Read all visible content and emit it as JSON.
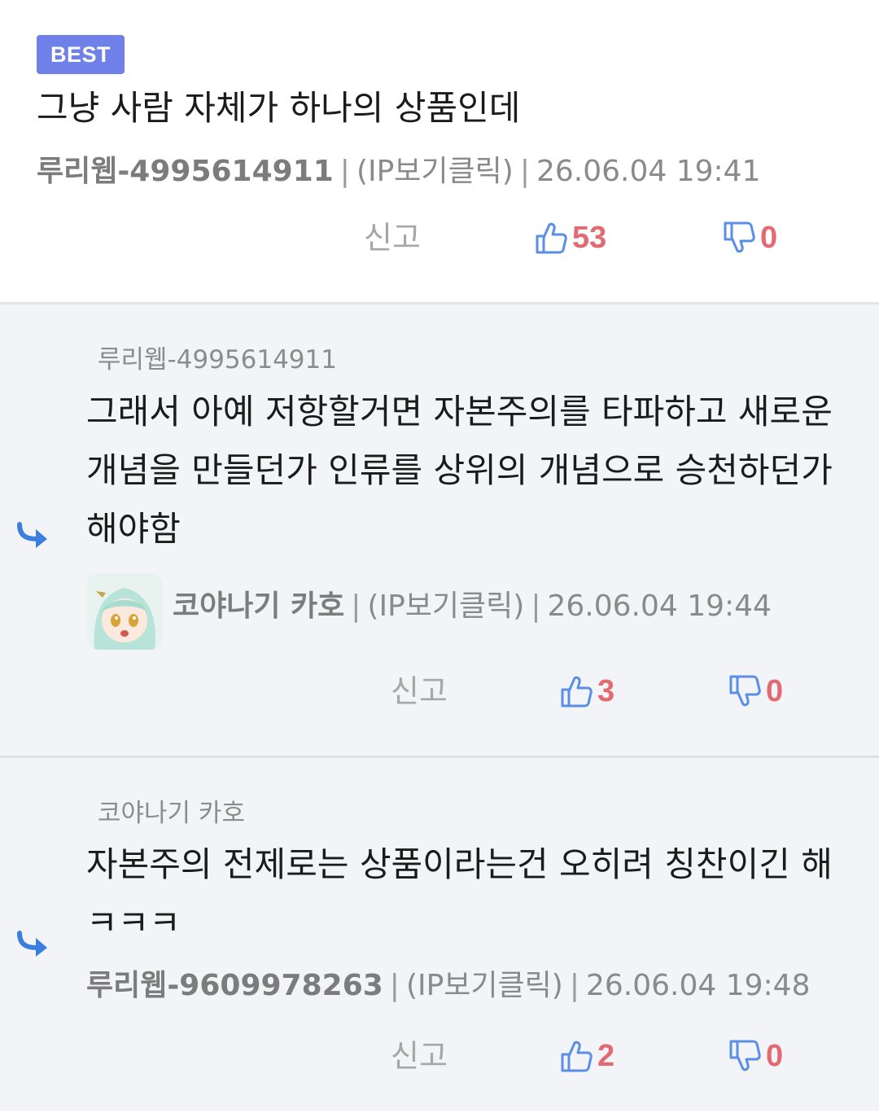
{
  "comments": [
    {
      "badge": "BEST",
      "text": "그냥 사람 자체가 하나의 상품인데",
      "author": "루리웹-4995614911",
      "ip": "(IP보기클릭)",
      "date": "26.06.04 19:41",
      "report": "신고",
      "likes": "53",
      "dislikes": "0"
    },
    {
      "reply_to": "루리웹-4995614911",
      "text": "그래서 아예 저항할거면 자본주의를 타파하고 새로운 개념을 만들던가 인류를 상위의 개념으로 승천하던가 해야함",
      "author": "코야나기 카호",
      "ip": "(IP보기클릭)",
      "date": "26.06.04 19:44",
      "report": "신고",
      "likes": "3",
      "dislikes": "0"
    },
    {
      "reply_to": "코야나기 카호",
      "text": "자본주의 전제로는 상품이라는건 오히려 칭찬이긴 해 ㅋㅋㅋ",
      "author": "루리웹-9609978263",
      "ip": "(IP보기클릭)",
      "date": "26.06.04 19:48",
      "report": "신고",
      "likes": "2",
      "dislikes": "0"
    }
  ],
  "separator": "|",
  "icons": {
    "like": "thumbs-up-icon",
    "dislike": "thumbs-down-icon",
    "reply": "reply-arrow-icon"
  },
  "colors": {
    "badge": "#6f80e8",
    "vote_count": "#e36a72",
    "thumb_icon": "#5b8ee6",
    "reply_arrow": "#3a7ee0"
  }
}
